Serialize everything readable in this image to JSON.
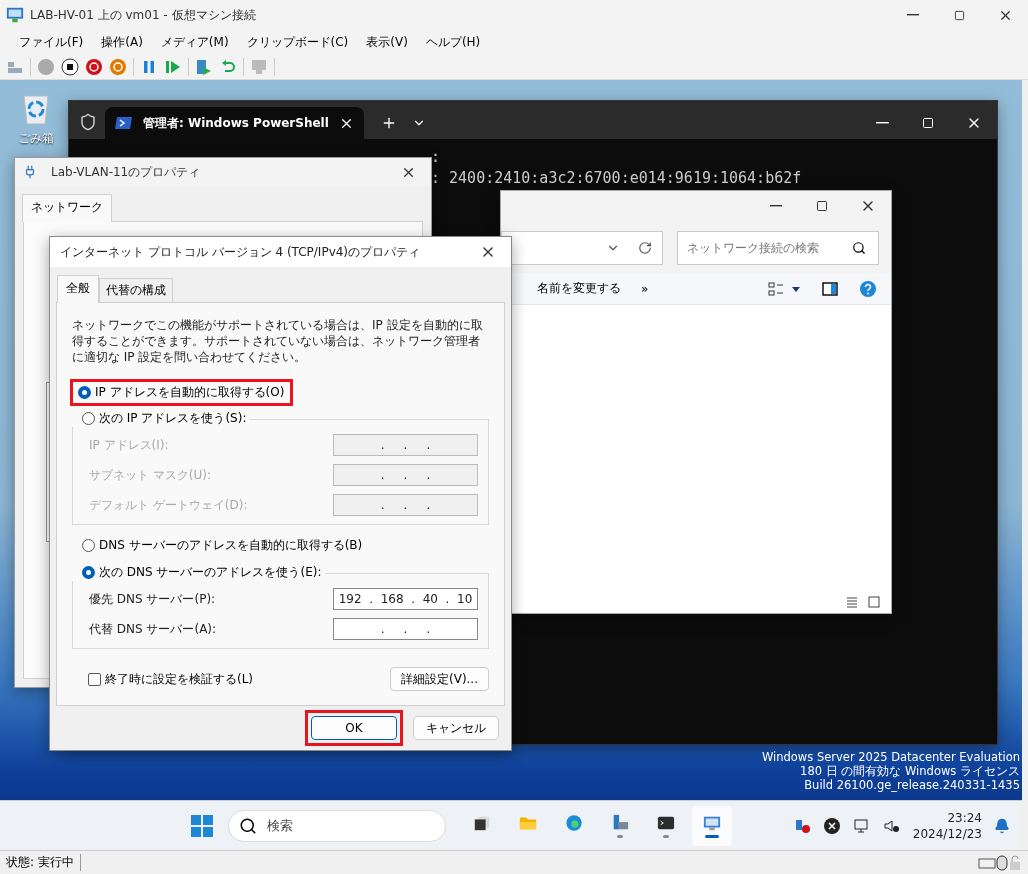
{
  "window": {
    "title": "LAB-HV-01 上の vm01  - 仮想マシン接続",
    "menu": [
      "ファイル(F)",
      "操作(A)",
      "メディア(M)",
      "クリップボード(C)",
      "表示(V)",
      "ヘルプ(H)"
    ]
  },
  "desktop": {
    "recycle_bin": "ごみ箱",
    "license_lines": [
      "Windows Server 2025 Datacenter Evaluation",
      "180 日 の間有効な Windows ライセンス",
      "Build 26100.ge_release.240331-1435"
    ]
  },
  "powershell": {
    "tab_title": "管理者: Windows PowerShell",
    "lines": [
      ":",
      ": 2400:2410:a3c2:6700:e014:9619:1064:b62f"
    ]
  },
  "adapter_properties": {
    "title": "Lab-VLAN-11のプロパティ",
    "tabs": [
      {
        "label": "ネットワーク",
        "selected": true
      }
    ]
  },
  "explorer": {
    "search_placeholder": "ネットワーク接続の検索",
    "command": "名前を変更する",
    "more": "»"
  },
  "ipv4_dialog": {
    "title": "インターネット プロトコル バージョン 4 (TCP/IPv4)のプロパティ",
    "tabs": [
      {
        "label": "全般",
        "selected": true
      },
      {
        "label": "代替の構成",
        "selected": false
      }
    ],
    "description": "ネットワークでこの機能がサポートされている場合は、IP 設定を自動的に取得することができます。サポートされていない場合は、ネットワーク管理者に適切な IP 設定を問い合わせてください。",
    "ip_auto": {
      "label": "IP アドレスを自動的に取得する(O)",
      "selected": true,
      "highlighted": true
    },
    "ip_manual": {
      "label": "次の IP アドレスを使う(S):",
      "selected": false
    },
    "ip_fields": [
      {
        "label": "IP アドレス(I):",
        "value": ".     .     .",
        "disabled": true
      },
      {
        "label": "サブネット マスク(U):",
        "value": ".     .     .",
        "disabled": true
      },
      {
        "label": "デフォルト ゲートウェイ(D):",
        "value": ".     .     .",
        "disabled": true
      }
    ],
    "dns_auto": {
      "label": "DNS サーバーのアドレスを自動的に取得する(B)",
      "selected": false
    },
    "dns_manual": {
      "label": "次の DNS サーバーのアドレスを使う(E):",
      "selected": true
    },
    "dns_fields": [
      {
        "label": "優先 DNS サーバー(P):",
        "value": "192  .  168  .  40  .  10",
        "disabled": false
      },
      {
        "label": "代替 DNS サーバー(A):",
        "value": ".     .     .",
        "disabled": false
      }
    ],
    "validate": {
      "label": "終了時に設定を検証する(L)",
      "checked": false
    },
    "advanced_button": "詳細設定(V)...",
    "buttons": [
      {
        "label": "OK",
        "highlighted": true,
        "default": true
      },
      {
        "label": "キャンセル",
        "highlighted": false,
        "default": false
      }
    ]
  },
  "taskbar": {
    "search_placeholder": "検索",
    "apps": [
      {
        "kind": "taskview",
        "running": false,
        "active": false
      },
      {
        "kind": "folder",
        "running": false,
        "active": false
      },
      {
        "kind": "browser",
        "running": false,
        "active": false
      },
      {
        "kind": "server",
        "running": true,
        "active": false
      },
      {
        "kind": "terminal",
        "running": true,
        "active": false
      },
      {
        "kind": "vm",
        "running": true,
        "active": true
      }
    ],
    "time": "23:24",
    "date": "2024/12/23"
  },
  "status_bar": {
    "text": "状態: 実行中"
  }
}
